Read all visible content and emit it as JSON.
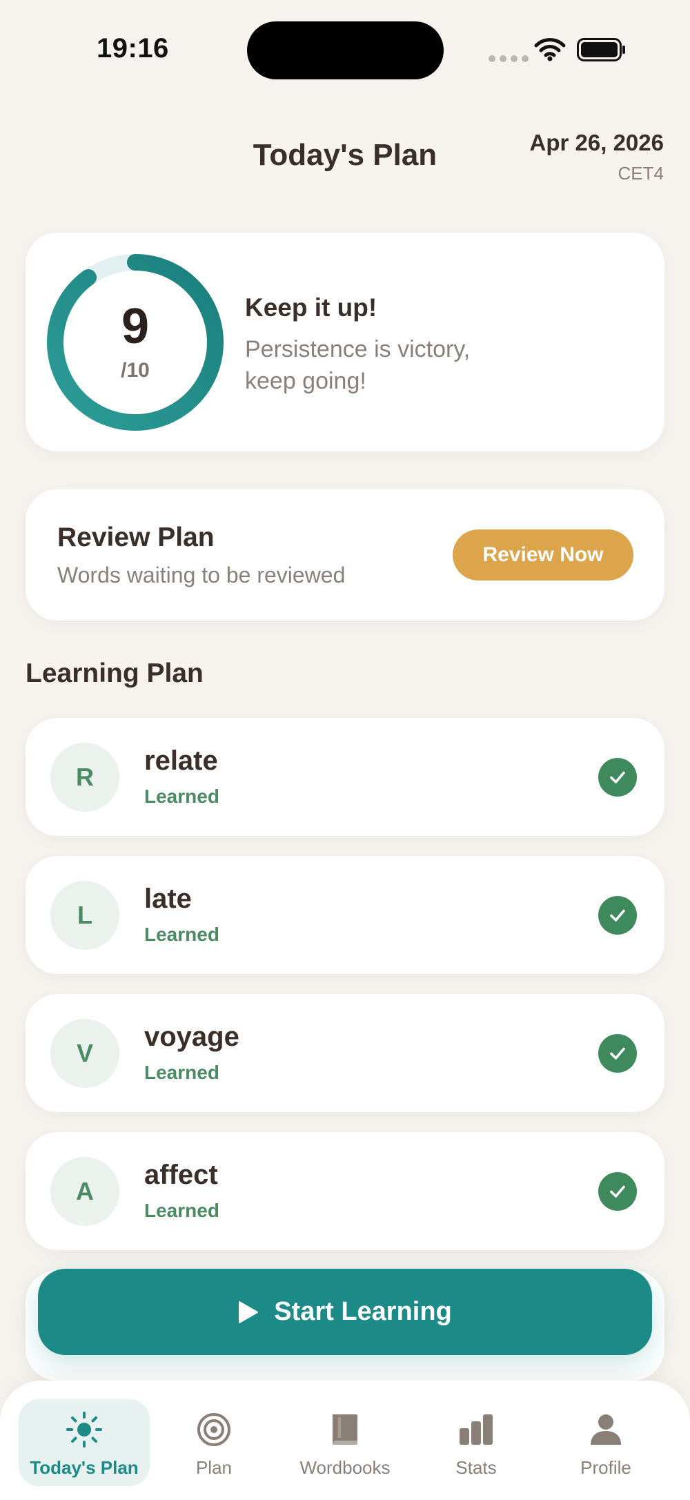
{
  "status_bar": {
    "time": "19:16"
  },
  "header": {
    "title": "Today's Plan",
    "date": "Apr 26, 2026",
    "wordbook": "CET4"
  },
  "progress": {
    "learned": "9",
    "total_label": "/10",
    "fraction": 0.9,
    "title": "Keep it up!",
    "subtitle": "Persistence is victory, keep going!"
  },
  "review": {
    "title": "Review Plan",
    "subtitle": "Words waiting to be reviewed",
    "button_label": "Review Now"
  },
  "learning_plan": {
    "heading": "Learning Plan",
    "words": [
      {
        "initial": "R",
        "word": "relate",
        "status": "Learned"
      },
      {
        "initial": "L",
        "word": "late",
        "status": "Learned"
      },
      {
        "initial": "V",
        "word": "voyage",
        "status": "Learned"
      },
      {
        "initial": "A",
        "word": "affect",
        "status": "Learned"
      }
    ]
  },
  "start_button": {
    "label": "Start Learning"
  },
  "tabs": [
    {
      "label": "Today's Plan",
      "icon": "sun-icon",
      "active": true
    },
    {
      "label": "Plan",
      "icon": "target-icon",
      "active": false
    },
    {
      "label": "Wordbooks",
      "icon": "book-icon",
      "active": false
    },
    {
      "label": "Stats",
      "icon": "bar-chart-icon",
      "active": false
    },
    {
      "label": "Profile",
      "icon": "person-icon",
      "active": false
    }
  ],
  "colors": {
    "accent": "#1C8B87",
    "review": "#DCA54B",
    "success": "#3F8A5C",
    "background": "#F6F3EF"
  }
}
